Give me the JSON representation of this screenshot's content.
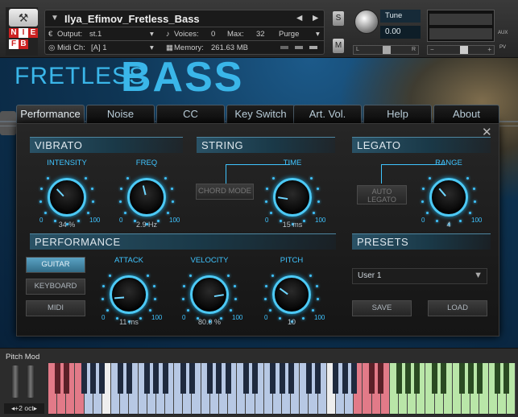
{
  "header": {
    "instrument_name": "Ilya_Efimov_Fretless_Bass",
    "logo_letters": [
      "N",
      "I",
      "E",
      "F",
      "B"
    ],
    "output_label": "Output:",
    "output_value": "st.1",
    "voices_label": "Voices:",
    "voices_value": "0",
    "max_label": "Max:",
    "max_value": "32",
    "purge_label": "Purge",
    "midi_label": "Midi Ch:",
    "midi_value": "[A]  1",
    "memory_label": "Memory:",
    "memory_value": "261.63 MB",
    "s_label": "S",
    "m_label": "M",
    "tune_label": "Tune",
    "tune_value": "0.00",
    "pan_l": "L",
    "pan_r": "R",
    "aux_label": "AUX",
    "pv_label": "PV"
  },
  "title": {
    "line1": "FRETLESS",
    "line2": "BASS"
  },
  "tabs": [
    "Performance",
    "Noise",
    "CC",
    "Key Switch",
    "Art. Vol.",
    "Help",
    "About"
  ],
  "active_tab": "Performance",
  "vibrato": {
    "header": "VIBRATO",
    "intensity": {
      "label": "INTENSITY",
      "value": "34 %",
      "min": "0",
      "max": "100",
      "level": 0.34
    },
    "freq": {
      "label": "FREQ",
      "value": "2.9 Hz",
      "min": "0",
      "max": "100",
      "level": 0.45
    }
  },
  "string": {
    "header": "STRING",
    "chord_mode": "CHORD MODE",
    "time": {
      "label": "TIME",
      "value": "15 ms",
      "min": "0",
      "max": "100",
      "level": 0.2
    }
  },
  "legato": {
    "header": "LEGATO",
    "auto_legato": "AUTO LEGATO",
    "range": {
      "label": "RANGE",
      "value": "4",
      "min": "0",
      "max": "100",
      "level": 0.35
    }
  },
  "performance": {
    "header": "PERFORMANCE",
    "modes": [
      "GUITAR",
      "KEYBOARD",
      "MIDI"
    ],
    "active_mode": "GUITAR",
    "attack": {
      "label": "ATTACK",
      "value": "11 ms",
      "min": "0",
      "max": "100",
      "level": 0.15
    },
    "velocity": {
      "label": "VELOCITY",
      "value": "80.0 %",
      "min": "0",
      "max": "100",
      "level": 0.8
    },
    "pitch": {
      "label": "PITCH",
      "value": "10",
      "min": "0",
      "max": "100",
      "level": 0.3
    }
  },
  "presets": {
    "header": "PRESETS",
    "selected": "User 1",
    "save": "SAVE",
    "load": "LOAD"
  },
  "footer": {
    "pitch_mod": "Pitch Mod",
    "octave": "+2 oct"
  },
  "colors": {
    "accent": "#3fc4ff",
    "background": "#0e3554",
    "keyswitch": "#e27a88",
    "range_blue": "#b7c8e4",
    "range_green": "#b9e6a8"
  }
}
